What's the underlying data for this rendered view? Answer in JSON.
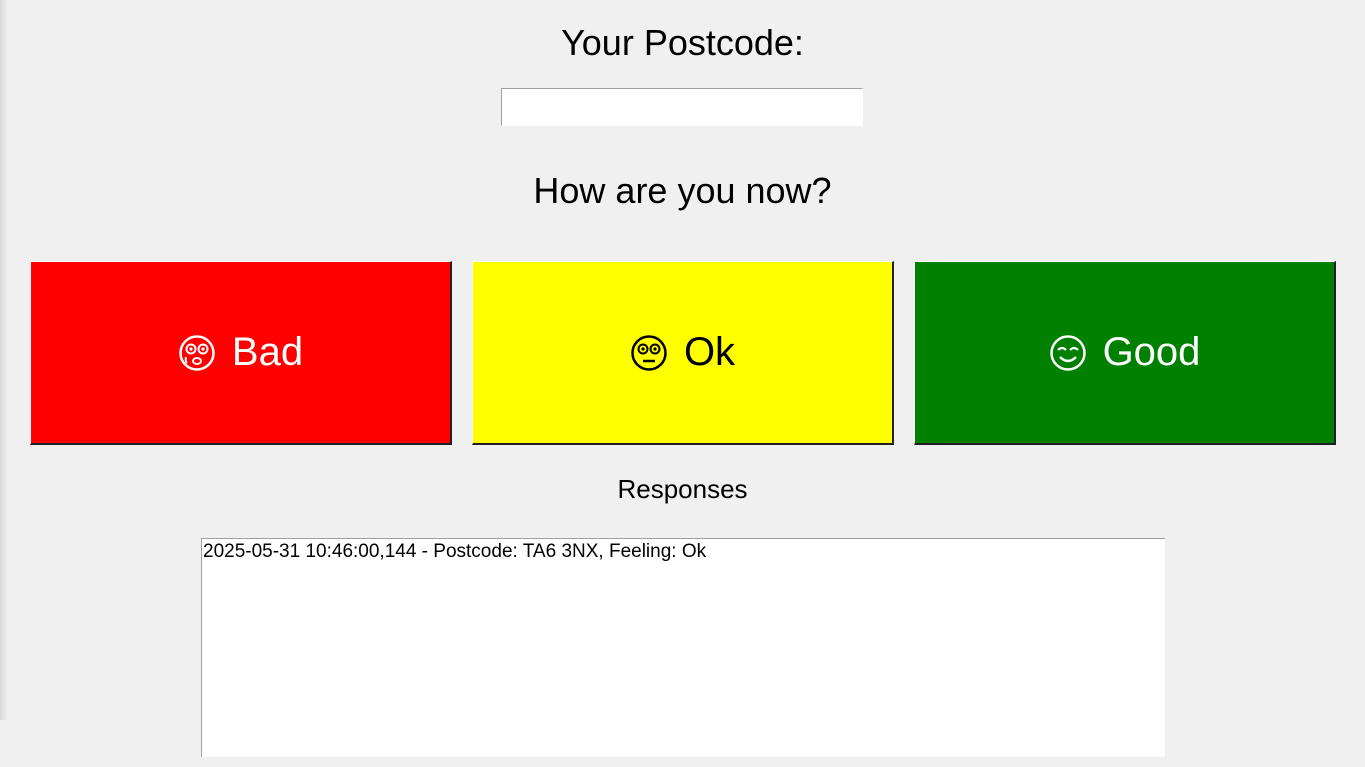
{
  "postcode": {
    "label": "Your Postcode:",
    "value": "",
    "placeholder": ""
  },
  "question": "How are you now?",
  "buttons": {
    "bad": {
      "label": "Bad",
      "icon": "flushed-face-icon",
      "color": "#ff0000"
    },
    "ok": {
      "label": "Ok",
      "icon": "neutral-face-icon",
      "color": "#ffff00"
    },
    "good": {
      "label": "Good",
      "icon": "smiling-face-icon",
      "color": "#008000"
    }
  },
  "responses": {
    "label": "Responses",
    "lines": [
      "2025-05-31 10:46:00,144 - Postcode: TA6 3NX, Feeling: Ok"
    ]
  }
}
